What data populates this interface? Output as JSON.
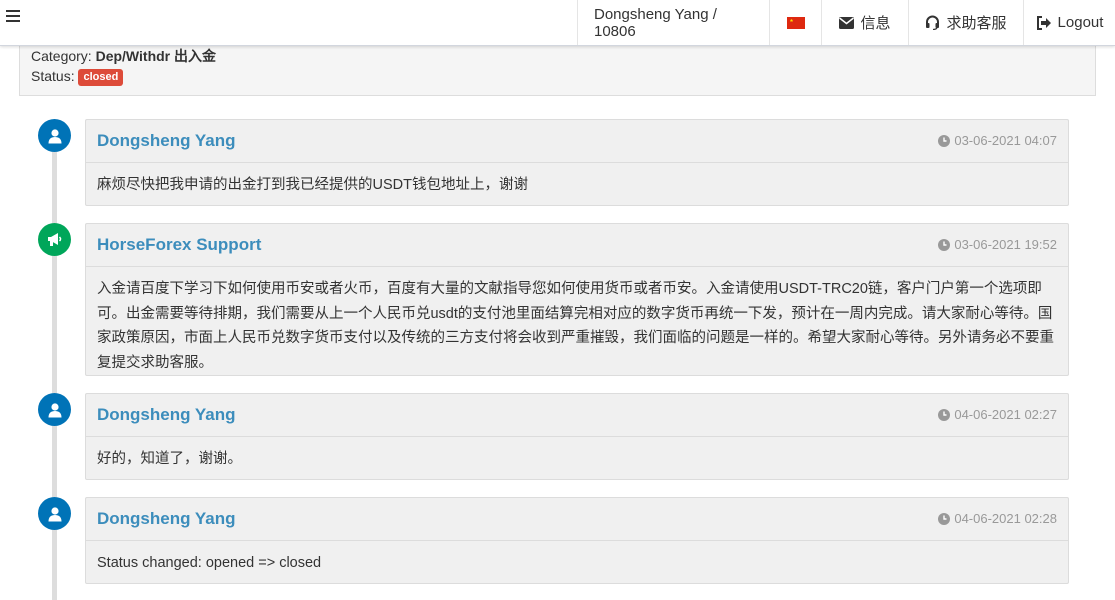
{
  "header": {
    "user_label": "Dongsheng Yang / 10806",
    "info_label": "信息",
    "help_label": "求助客服",
    "logout_label": "Logout"
  },
  "ticket": {
    "category_label": "Category:",
    "category_value": "Dep/Withdr 出入金",
    "status_label": "Status:",
    "status_value": "closed"
  },
  "colors": {
    "accent": "#3c8dbc",
    "user_icon": "#0073b7",
    "support_icon": "#00a65a",
    "badge_closed": "#dd4b39"
  },
  "timeline": [
    {
      "author": "Dongsheng Yang",
      "icon": "user-icon",
      "time": "03-06-2021 04:07",
      "message": "麻烦尽快把我申请的出金打到我已经提供的USDT钱包地址上，谢谢"
    },
    {
      "author": "HorseForex Support",
      "icon": "bullhorn-icon",
      "time": "03-06-2021 19:52",
      "message": "入金请百度下学习下如何使用币安或者火币，百度有大量的文献指导您如何使用货币或者币安。入金请使用USDT-TRC20链，客户门户第一个选项即可。出金需要等待排期，我们需要从上一个人民币兑usdt的支付池里面结算完相对应的数字货币再统一下发，预计在一周内完成。请大家耐心等待。国家政策原因，市面上人民币兑数字货币支付以及传统的三方支付将会收到严重摧毁，我们面临的问题是一样的。希望大家耐心等待。另外请务必不要重复提交求助客服。"
    },
    {
      "author": "Dongsheng Yang",
      "icon": "user-icon",
      "time": "04-06-2021 02:27",
      "message": "好的，知道了，谢谢。"
    },
    {
      "author": "Dongsheng Yang",
      "icon": "user-icon",
      "time": "04-06-2021 02:28",
      "message": "Status changed: opened => closed"
    }
  ]
}
